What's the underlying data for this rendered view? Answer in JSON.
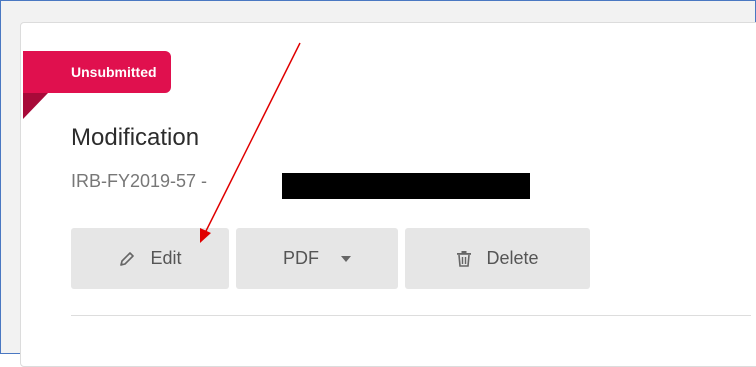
{
  "status_badge": {
    "label": "Unsubmitted",
    "color": "#e0104e"
  },
  "submission": {
    "title": "Modification",
    "id_prefix": "IRB-FY2019-57 -"
  },
  "actions": {
    "edit": {
      "label": "Edit",
      "icon": "pencil-icon"
    },
    "pdf": {
      "label": "PDF",
      "icon": "chevron-down-icon"
    },
    "delete": {
      "label": "Delete",
      "icon": "trash-icon"
    }
  },
  "annotation": {
    "arrow_color": "#e00000",
    "arrow_target": "edit-button"
  }
}
